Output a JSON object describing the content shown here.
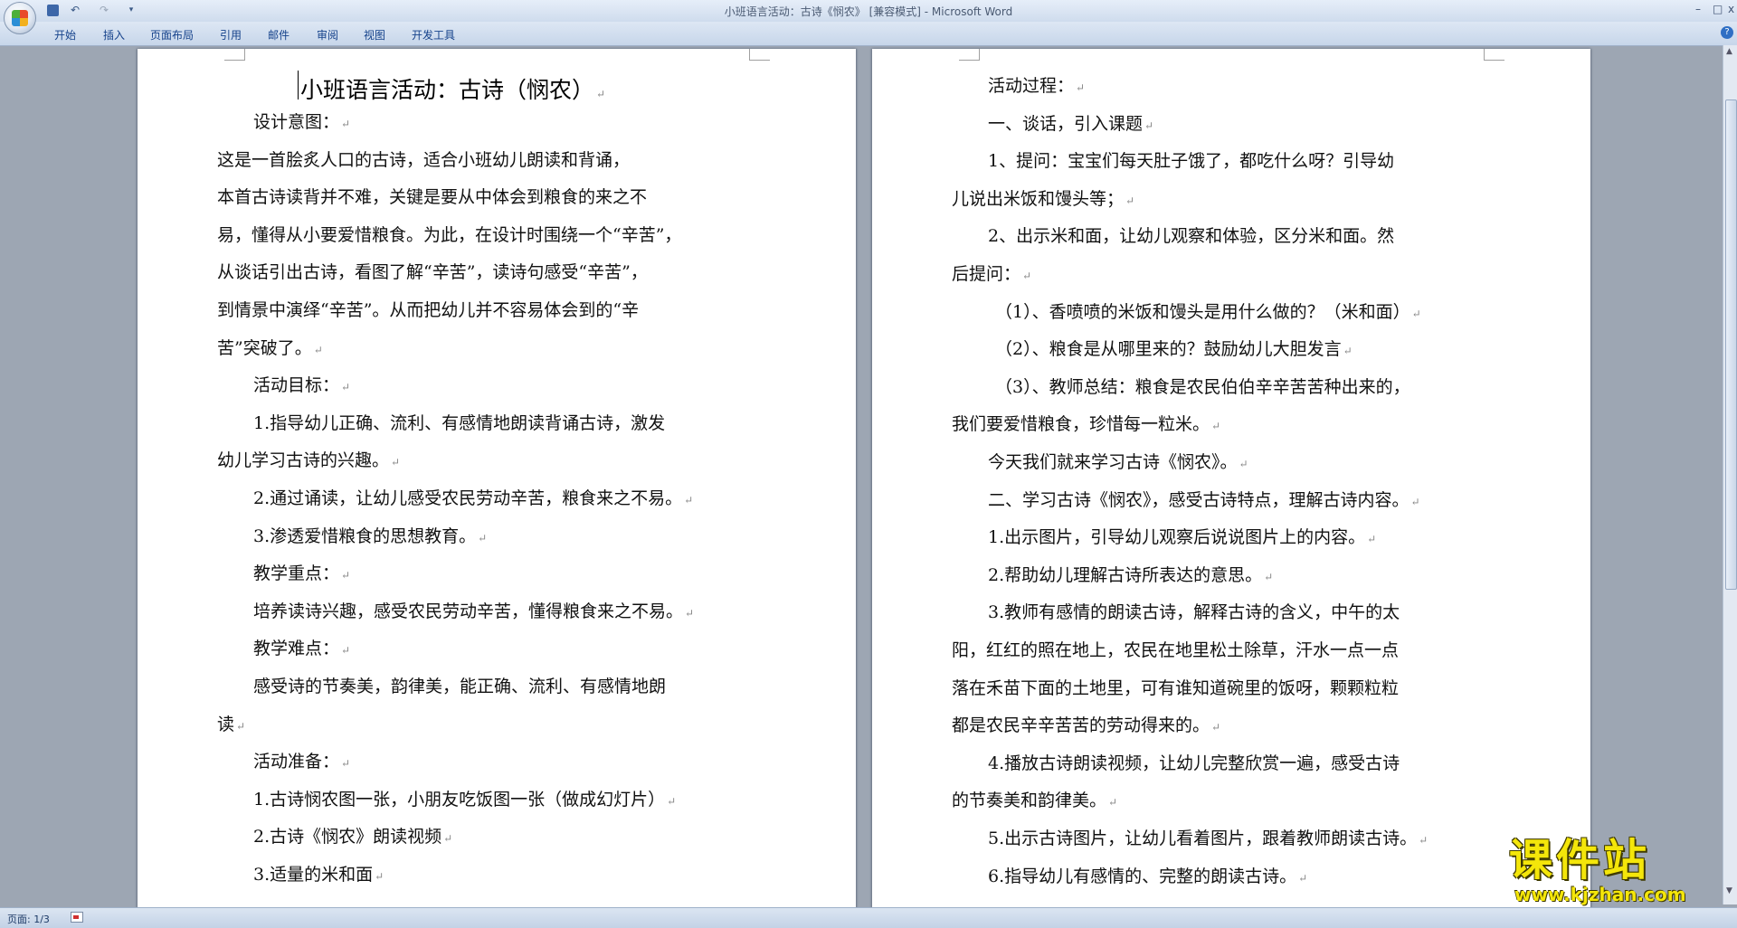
{
  "window": {
    "title": "小班语言活动：古诗《悯农》 [兼容模式] - Microsoft Word",
    "minimize": "–",
    "maximize": "□",
    "close": "x",
    "help": "?"
  },
  "quick_access": {
    "undo": "↶",
    "redo": "↷",
    "more": "▾"
  },
  "ribbon": {
    "tabs": [
      "开始",
      "插入",
      "页面布局",
      "引用",
      "邮件",
      "审阅",
      "视图",
      "开发工具"
    ]
  },
  "document": {
    "title": "小班语言活动：古诗（悯农）",
    "para_mark": "↵",
    "left_page_lines": [
      "设计意图：",
      "这是一首脍炙人口的古诗，适合小班幼儿朗读和背诵，",
      "本首古诗读背并不难，关键是要从中体会到粮食的来之不",
      "易，懂得从小要爱惜粮食。为此，在设计时围绕一个“辛苦”，",
      "从谈话引出古诗，看图了解“辛苦”，读诗句感受“辛苦”，",
      "到情景中演绎“辛苦”。从而把幼儿并不容易体会到的“辛",
      "苦”突破了。",
      "活动目标：",
      "1.指导幼儿正确、流利、有感情地朗读背诵古诗，激发",
      "幼儿学习古诗的兴趣。",
      "2.通过诵读，让幼儿感受农民劳动辛苦，粮食来之不易。",
      "3.渗透爱惜粮食的思想教育。",
      "教学重点：",
      "培养读诗兴趣，感受农民劳动辛苦，懂得粮食来之不易。",
      "教学难点：",
      "感受诗的节奏美，韵律美，能正确、流利、有感情地朗",
      "读",
      "活动准备：",
      "1.古诗悯农图一张，小朋友吃饭图一张（做成幻灯片）",
      "2.古诗《悯农》朗读视频",
      "3.适量的米和面"
    ],
    "right_page_lines": [
      "活动过程：",
      "一、谈话，引入课题",
      "1、提问：宝宝们每天肚子饿了，都吃什么呀？引导幼",
      "儿说出米饭和馒头等；",
      "2、出示米和面，让幼儿观察和体验，区分米和面。然",
      "后提问：",
      "（1）、香喷喷的米饭和馒头是用什么做的？（米和面）",
      "（2）、粮食是从哪里来的？鼓励幼儿大胆发言",
      "（3）、教师总结：粮食是农民伯伯辛辛苦苦种出来的，",
      "我们要爱惜粮食，珍惜每一粒米。",
      "今天我们就来学习古诗《悯农》。",
      "二、学习古诗《悯农》，感受古诗特点，理解古诗内容。",
      "1.出示图片，引导幼儿观察后说说图片上的内容。",
      "2.帮助幼儿理解古诗所表达的意思。",
      "3.教师有感情的朗读古诗，解释古诗的含义，中午的太",
      "阳，红红的照在地上，农民在地里松土除草，汗水一点一点",
      "落在禾苗下面的土地里，可有谁知道碗里的饭呀，颗颗粒粒",
      "都是农民辛辛苦苦的劳动得来的。",
      "4.播放古诗朗读视频，让幼儿完整欣赏一遍，感受古诗",
      "的节奏美和韵律美。",
      "5.出示古诗图片，让幼儿看着图片，跟着教师朗读古诗。",
      "6.指导幼儿有感情的、完整的朗读古诗。"
    ]
  },
  "status_bar": {
    "page": "页面: 1/3"
  },
  "watermark": {
    "title": "课件站",
    "url": "www.kjzhan.com"
  }
}
